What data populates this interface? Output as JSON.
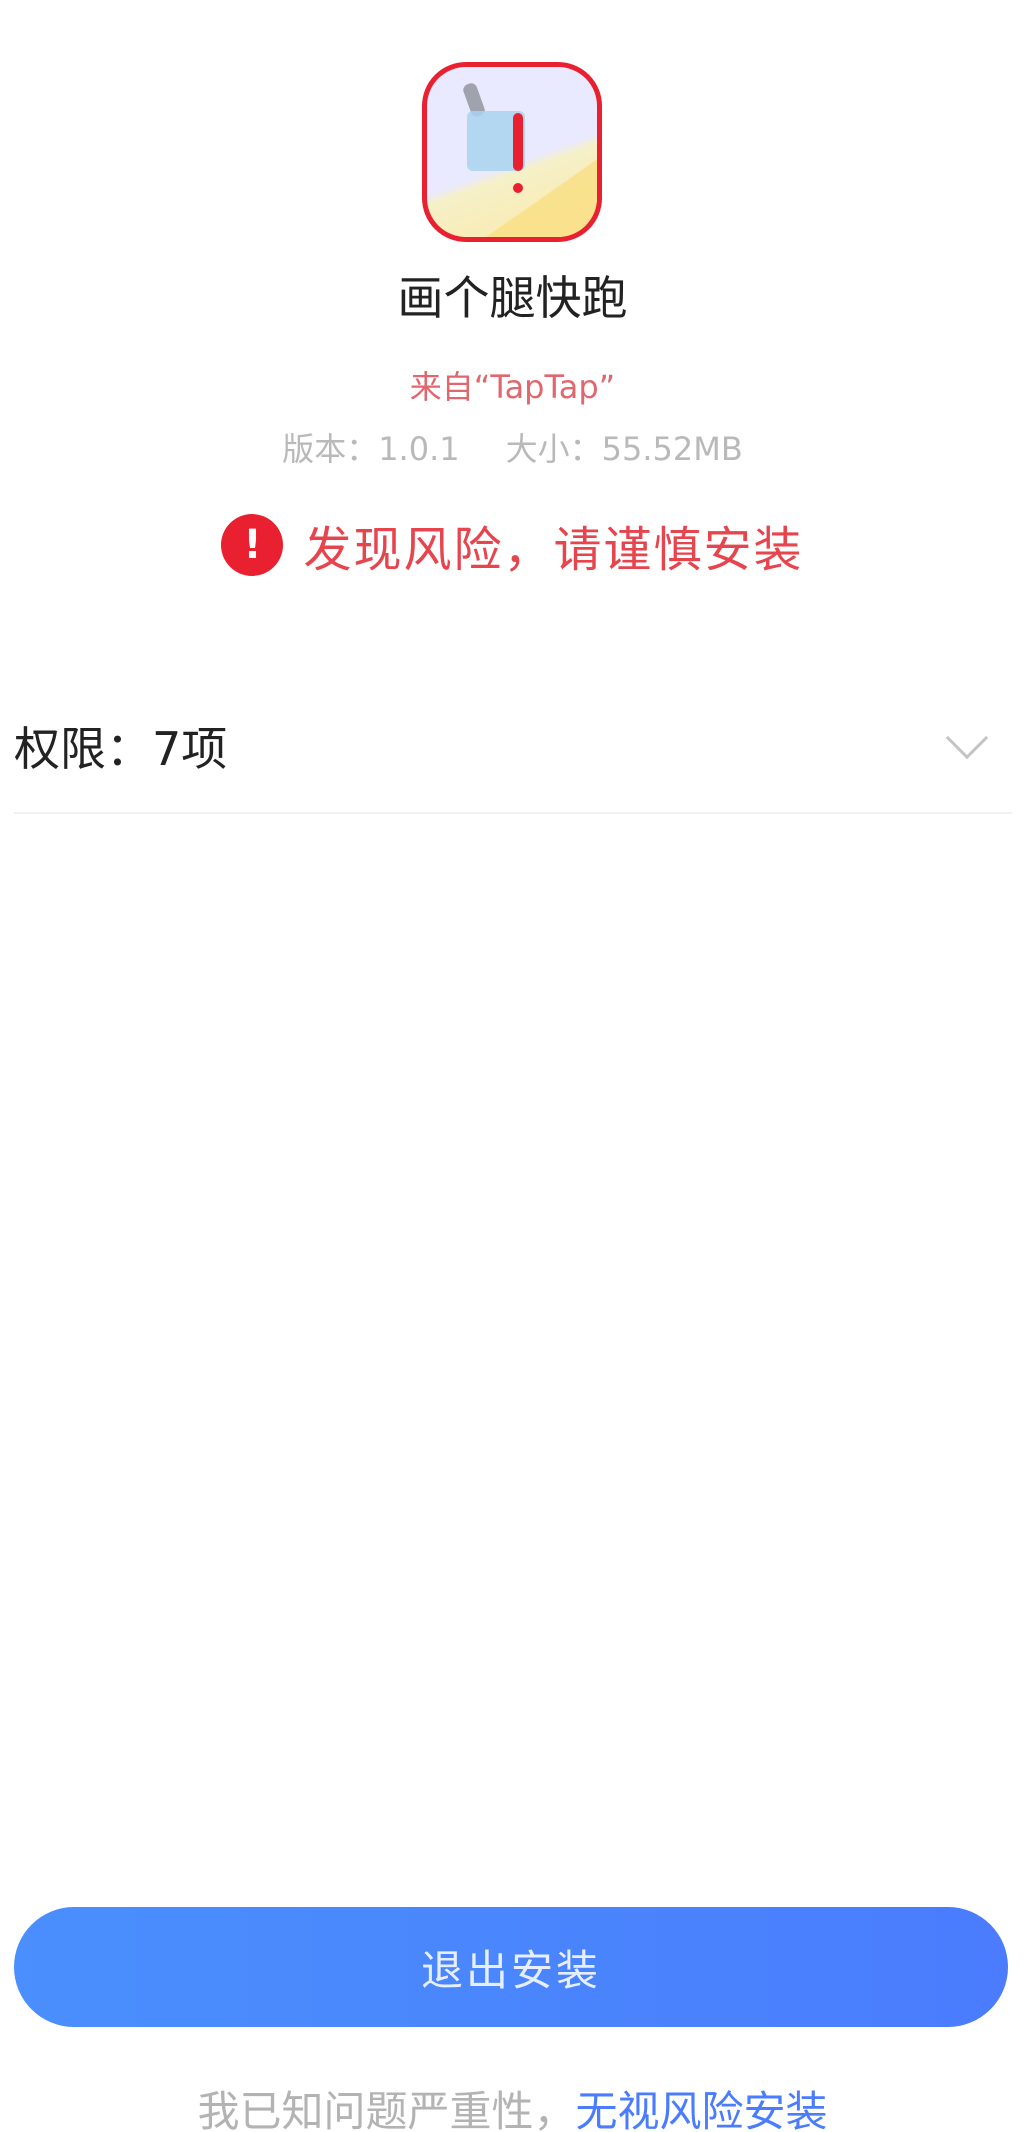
{
  "app": {
    "icon": "app-icon-with-warning",
    "name": "画个腿快跑",
    "source": "来自“TapTap”",
    "version_text": "版本：1.0.1",
    "size_text": "大小：55.52MB"
  },
  "risk": {
    "icon": "exclamation-circle-icon",
    "icon_glyph": "!",
    "text": "发现风险，请谨慎安装"
  },
  "permissions": {
    "label": "权限：7项",
    "expand_icon": "chevron-down-icon"
  },
  "actions": {
    "exit_label": "退出安装",
    "ignore_prefix": "我已知问题严重性，",
    "ignore_link": "无视风险安装"
  },
  "colors": {
    "danger": "#e8202f",
    "primary": "#4a7cfd"
  }
}
